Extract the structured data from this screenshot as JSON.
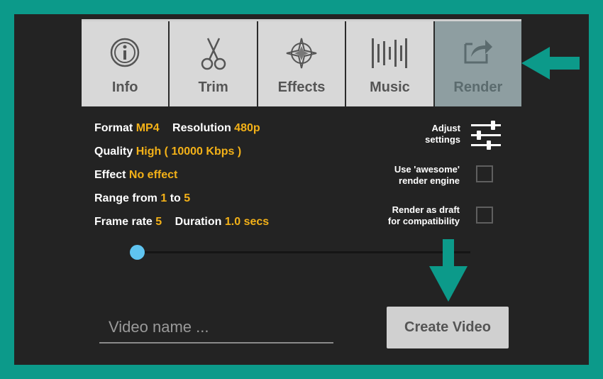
{
  "tabs": [
    {
      "label": "Info",
      "icon": "info-icon"
    },
    {
      "label": "Trim",
      "icon": "scissors-icon"
    },
    {
      "label": "Effects",
      "icon": "effects-icon"
    },
    {
      "label": "Music",
      "icon": "music-waveform-icon"
    },
    {
      "label": "Render",
      "icon": "share-icon",
      "active": true
    }
  ],
  "info": {
    "format_label": "Format",
    "format_value": "MP4",
    "resolution_label": "Resolution",
    "resolution_value": "480p",
    "quality_label": "Quality",
    "quality_value": "High ( 10000 Kbps )",
    "effect_label": "Effect",
    "effect_value": "No effect",
    "range_label": "Range from",
    "range_from": "1",
    "range_to_label": "to",
    "range_to": "5",
    "framerate_label": "Frame rate",
    "framerate_value": "5",
    "duration_label": "Duration",
    "duration_value": "1.0 secs"
  },
  "settings": {
    "adjust_line1": "Adjust",
    "adjust_line2": "settings",
    "awesome_line1": "Use 'awesome'",
    "awesome_line2": "render engine",
    "draft_line1": "Render as draft",
    "draft_line2": "for compatibility"
  },
  "slider": {
    "value_fraction": 0.0
  },
  "video_name": {
    "placeholder": "Video name ...",
    "value": ""
  },
  "create_button": {
    "label": "Create Video"
  },
  "colors": {
    "accent": "#f3b118",
    "frame": "#0c9a8a",
    "thumb": "#5fc4f0",
    "active_tab": "#8e9ea1"
  }
}
